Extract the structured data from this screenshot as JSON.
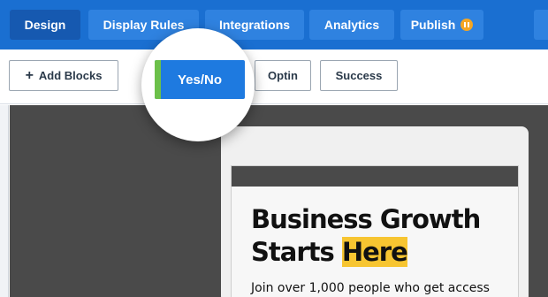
{
  "nav": {
    "tabs": [
      {
        "label": "Design",
        "active": true
      },
      {
        "label": "Display Rules",
        "active": false
      },
      {
        "label": "Integrations",
        "active": false
      },
      {
        "label": "Analytics",
        "active": false
      },
      {
        "label": "Publish",
        "active": false,
        "status_icon": "pause-icon"
      }
    ]
  },
  "toolbar": {
    "add_blocks_label": "Add Blocks",
    "add_icon": "+",
    "view_buttons": [
      {
        "label": "Yes/No",
        "selected": true
      },
      {
        "label": "Optin",
        "selected": false
      },
      {
        "label": "Success",
        "selected": false
      }
    ]
  },
  "preview": {
    "headline_line1": "Business Growth",
    "headline_line2_prefix": "Starts ",
    "headline_line2_highlight": "Here",
    "subtext": "Join over 1,000 people who get access"
  },
  "colors": {
    "nav_bg": "#1a6fd1",
    "tab_bg": "#2f82e0",
    "tab_active_bg": "#1659b0",
    "publish_status": "#f5a623",
    "yesno_bg": "#1e7ae0",
    "yesno_accent": "#6cc04a",
    "headline_highlight": "#f7c531",
    "canvas_bg": "#4a4a4a"
  }
}
